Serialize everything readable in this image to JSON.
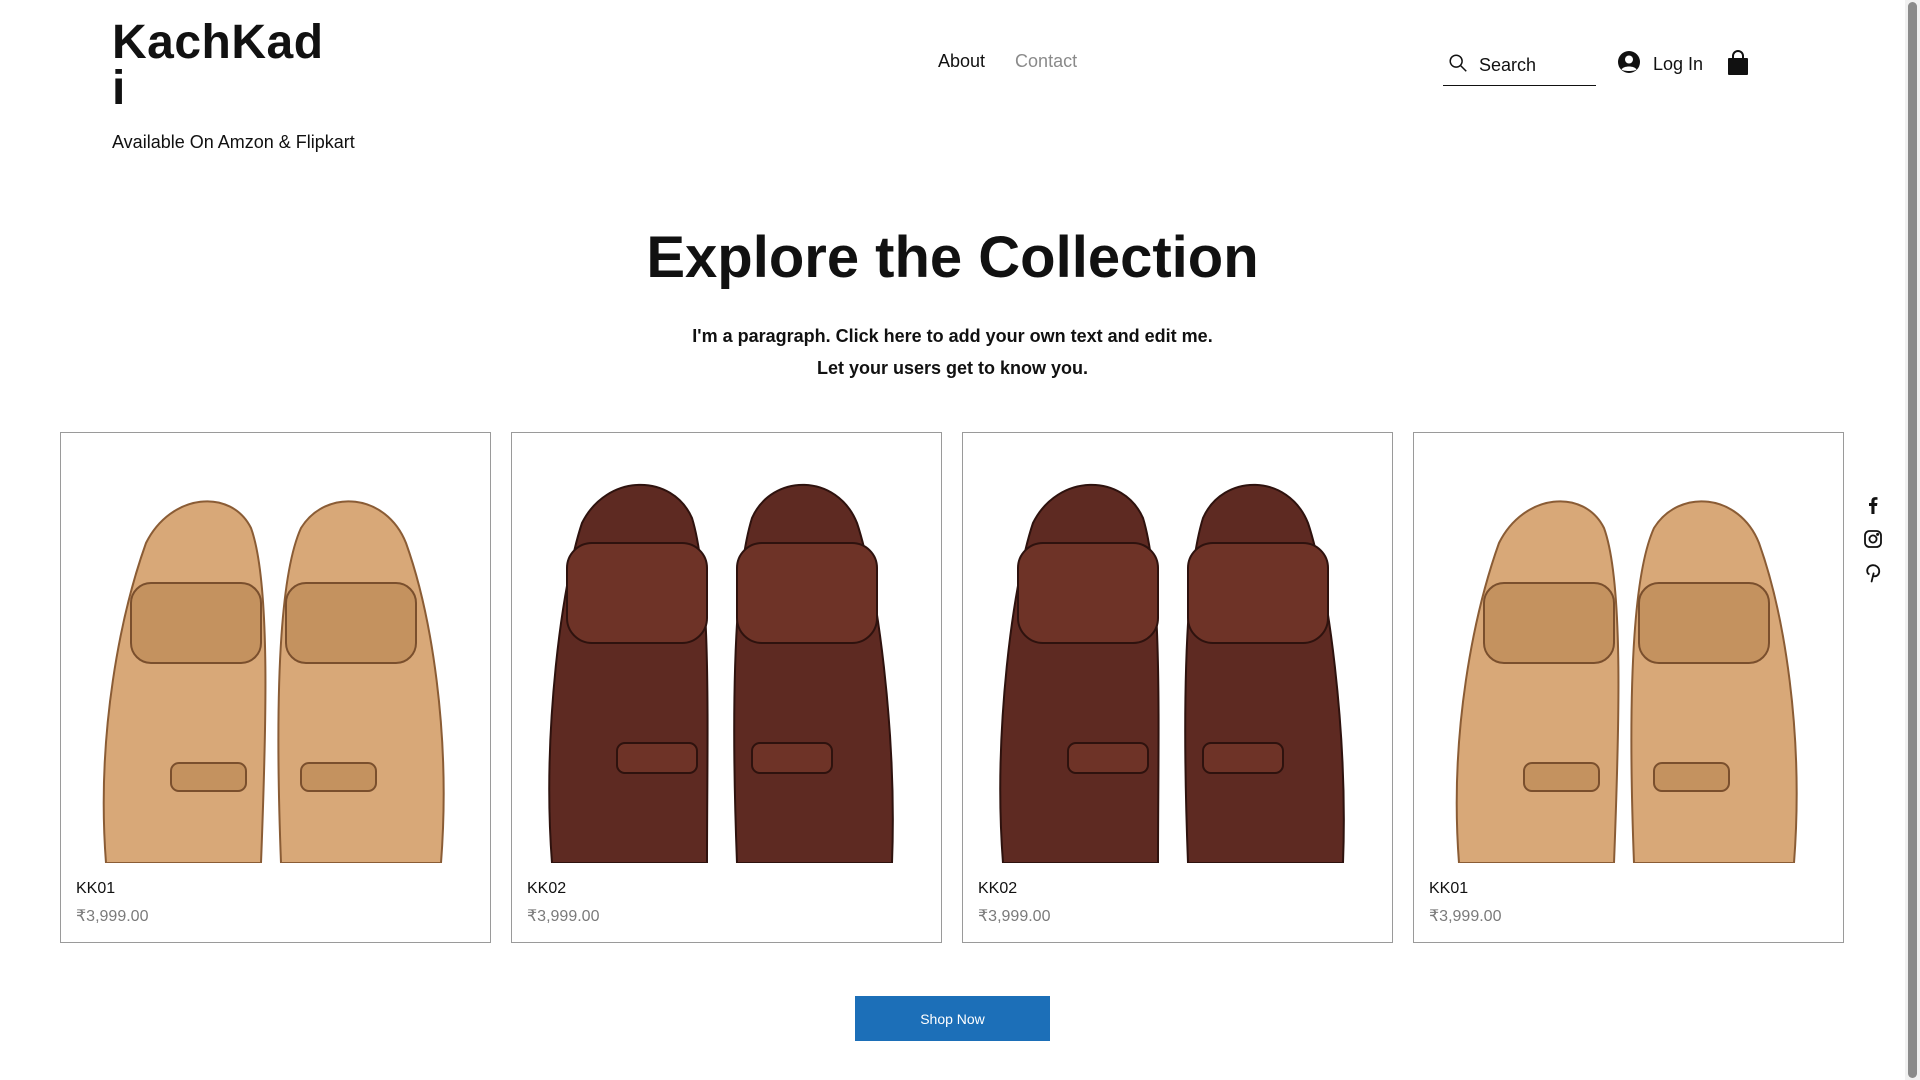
{
  "header": {
    "brand_name": "KachKadi",
    "brand_tagline": "Available On Amzon & Flipkart",
    "nav": {
      "about": "About",
      "contact": "Contact"
    },
    "search_placeholder": "Search",
    "login_label": "Log In"
  },
  "hero": {
    "title": "Explore the Collection",
    "paragraph_line1": "I'm a paragraph. Click here to add your own text and edit me.",
    "paragraph_line2": "Let your users get to know you."
  },
  "products": [
    {
      "name": "KK01",
      "price": "₹3,999.00",
      "color": "tan"
    },
    {
      "name": "KK02",
      "price": "₹3,999.00",
      "color": "brown"
    },
    {
      "name": "KK02",
      "price": "₹3,999.00",
      "color": "brown"
    },
    {
      "name": "KK01",
      "price": "₹3,999.00",
      "color": "tan"
    }
  ],
  "cta": {
    "shop_label": "Shop Now"
  },
  "social": [
    "facebook-icon",
    "instagram-icon",
    "pinterest-icon"
  ],
  "colors": {
    "accent": "#1c6fb8",
    "text": "#111111",
    "muted": "#8a8a8a",
    "tan_leather": "#d8a878",
    "brown_leather": "#5e2a22"
  }
}
